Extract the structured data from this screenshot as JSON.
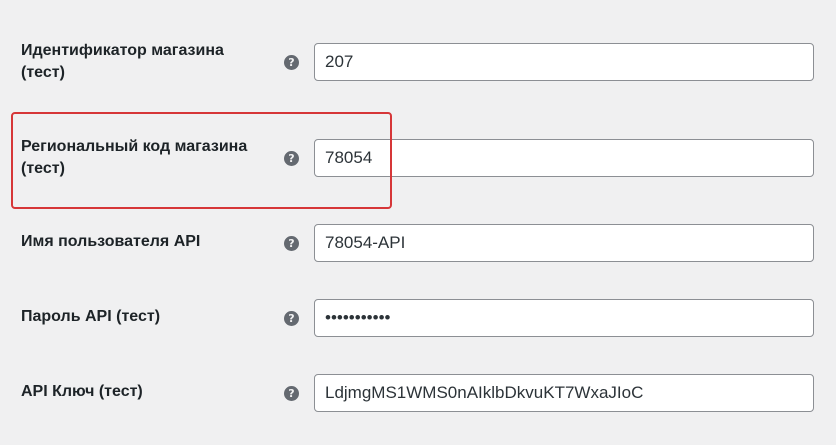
{
  "fields": [
    {
      "label": "Идентификатор магазина (тест)",
      "value": "207",
      "type": "text",
      "help_glyph": "?",
      "help_icon": "question-circle-icon"
    },
    {
      "label": "Региональный код магазина (тест)",
      "value": "78054",
      "type": "text",
      "help_glyph": "?",
      "help_icon": "question-circle-icon"
    },
    {
      "label": "Имя пользователя API",
      "value": "78054-API",
      "type": "text",
      "help_glyph": "?",
      "help_icon": "question-circle-icon"
    },
    {
      "label": "Пароль API (тест)",
      "value": "•••••••••••",
      "type": "password",
      "help_glyph": "?",
      "help_icon": "question-circle-icon"
    },
    {
      "label": "API Ключ (тест)",
      "value": "LdjmgMS1WMS0nAIklbDkvuKT7WxaJIoC",
      "type": "text",
      "help_glyph": "?",
      "help_icon": "question-circle-icon"
    }
  ],
  "highlight": {
    "color": "#d63638",
    "target": "Региональный код магазина (тест)"
  }
}
